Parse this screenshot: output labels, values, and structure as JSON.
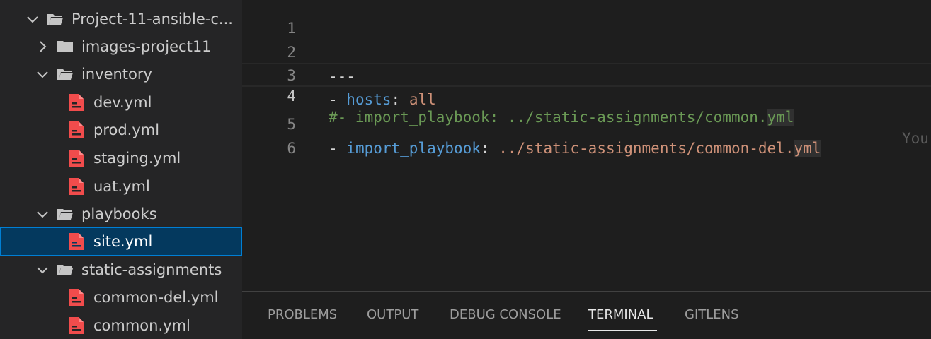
{
  "explorer": {
    "root": {
      "label": "Project-11-ansible-c...",
      "expanded": true
    },
    "items": [
      {
        "label": "images-project11",
        "type": "folder",
        "expanded": false
      },
      {
        "label": "inventory",
        "type": "folder",
        "expanded": true
      },
      {
        "label": "dev.yml",
        "type": "yaml-file"
      },
      {
        "label": "prod.yml",
        "type": "yaml-file"
      },
      {
        "label": "staging.yml",
        "type": "yaml-file"
      },
      {
        "label": "uat.yml",
        "type": "yaml-file"
      },
      {
        "label": "playbooks",
        "type": "folder",
        "expanded": true
      },
      {
        "label": "site.yml",
        "type": "yaml-file",
        "selected": true
      },
      {
        "label": "static-assignments",
        "type": "folder",
        "expanded": true
      },
      {
        "label": "common-del.yml",
        "type": "yaml-file"
      },
      {
        "label": "common.yml",
        "type": "yaml-file"
      }
    ]
  },
  "editor": {
    "current_line": 4,
    "lines": [
      {
        "number": "1",
        "text": ""
      },
      {
        "number": "2",
        "text": "---"
      },
      {
        "number": "3",
        "text": "- hosts: all"
      },
      {
        "number": "4",
        "text": "#- import_playbook: ../static-assignments/common.yml"
      },
      {
        "number": "5",
        "text": "- import_playbook: ../static-assignments/common-del.yml"
      },
      {
        "number": "6",
        "text": ""
      }
    ],
    "ghost_text": "You"
  },
  "panel": {
    "tabs": [
      {
        "label": "PROBLEMS",
        "active": false
      },
      {
        "label": "OUTPUT",
        "active": false
      },
      {
        "label": "DEBUG CONSOLE",
        "active": false
      },
      {
        "label": "TERMINAL",
        "active": true
      },
      {
        "label": "GITLENS",
        "active": false
      }
    ]
  },
  "colors": {
    "sidebar_bg": "#252526",
    "editor_bg": "#1e1e1e",
    "selection_bg": "#04395e",
    "selection_border": "#007fd4",
    "yaml_icon": "#f14c4c",
    "folder_icon": "#c5c5c5"
  }
}
